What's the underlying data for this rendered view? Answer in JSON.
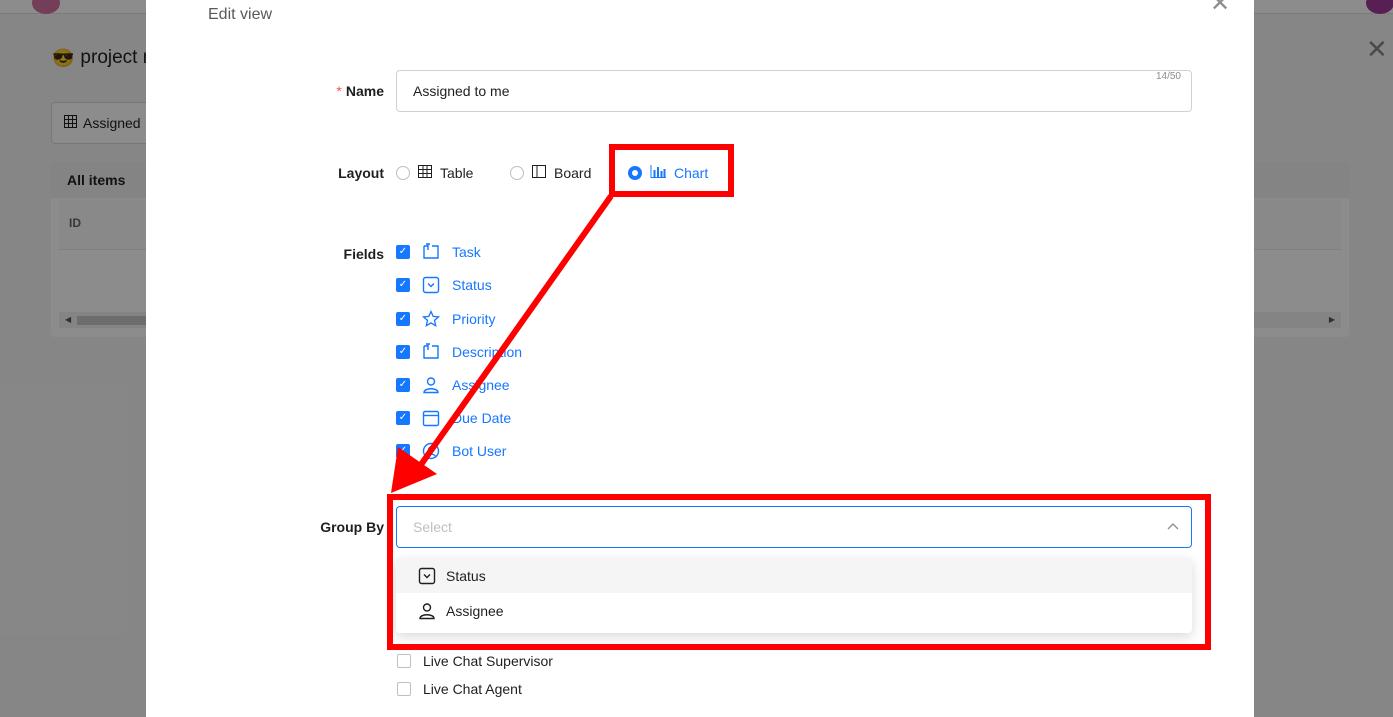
{
  "background": {
    "project_title": "project r",
    "view_button_label": "Assigned",
    "card_header": "All items",
    "column_id": "ID"
  },
  "modal": {
    "title": "Edit view",
    "name": {
      "label": "Name",
      "required_mark": "*",
      "value": "Assigned to me",
      "counter": "14/50"
    },
    "layout": {
      "label": "Layout",
      "options": [
        {
          "label": "Table",
          "icon": "table-icon",
          "selected": false
        },
        {
          "label": "Board",
          "icon": "board-icon",
          "selected": false
        },
        {
          "label": "Chart",
          "icon": "chart-icon",
          "selected": true
        }
      ]
    },
    "fields": {
      "label": "Fields",
      "items": [
        {
          "label": "Task",
          "icon": "text-field-icon",
          "checked": true
        },
        {
          "label": "Status",
          "icon": "dropdown-field-icon",
          "checked": true
        },
        {
          "label": "Priority",
          "icon": "star-icon",
          "checked": true
        },
        {
          "label": "Description",
          "icon": "text-field-icon",
          "checked": true
        },
        {
          "label": "Assignee",
          "icon": "person-icon",
          "checked": true
        },
        {
          "label": "Due Date",
          "icon": "calendar-icon",
          "checked": true
        },
        {
          "label": "Bot User",
          "icon": "bot-user-icon",
          "checked": true
        }
      ]
    },
    "group_by": {
      "label": "Group By",
      "placeholder": "Select",
      "options": [
        {
          "label": "Status",
          "icon": "dropdown-field-icon",
          "highlighted": true
        },
        {
          "label": "Assignee",
          "icon": "person-icon",
          "highlighted": false
        }
      ]
    },
    "roles": [
      {
        "label": "Live Chat Supervisor",
        "checked": false
      },
      {
        "label": "Live Chat Agent",
        "checked": false
      }
    ]
  },
  "annotation": {
    "color": "#ff0000"
  }
}
